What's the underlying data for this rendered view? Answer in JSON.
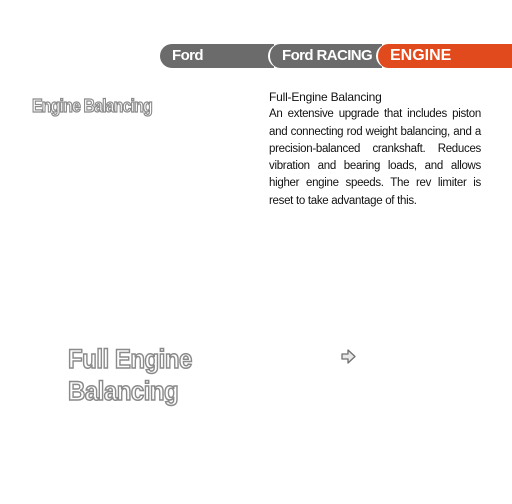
{
  "tabs": {
    "ford": "Ford",
    "racing": "Ford RACING",
    "engine": "ENGINE"
  },
  "section": {
    "title": "Engine Balancing"
  },
  "description": {
    "title": "Full-Engine Balancing",
    "body": "An extensive upgrade that includes pis­ton and connecting rod weight balanc­ing, and a precision-balanced crank­shaft. Reduces vibration and bearing loads, and allows higher engine speeds. The rev limiter is reset to take advantage of this."
  },
  "upgrade": {
    "line1": "Full Engine",
    "line2": "Balancing"
  },
  "navigation": {
    "icon": "right-arrow-icon"
  },
  "colors": {
    "tab_gray": "#6b6b6b",
    "tab_accent": "#e14a1d",
    "outline_text": "#8a8a8a"
  }
}
